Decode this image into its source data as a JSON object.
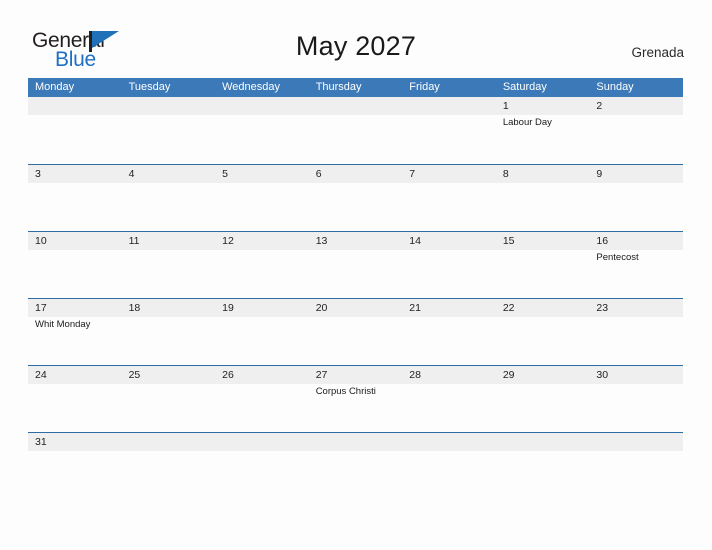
{
  "brand": {
    "name_part1": "General",
    "name_part2": "Blue",
    "flag_icon": "flag-icon"
  },
  "header": {
    "title": "May 2027",
    "region": "Grenada"
  },
  "colors": {
    "header_blue": "#3b79b8",
    "rule_blue": "#2e6da4",
    "band_gray": "#efefef",
    "brand_blue": "#1f6fc4",
    "page_bg": "#fdfdfd"
  },
  "calendar": {
    "weekday_headers": [
      "Monday",
      "Tuesday",
      "Wednesday",
      "Thursday",
      "Friday",
      "Saturday",
      "Sunday"
    ],
    "weeks": [
      [
        {
          "day": "",
          "events": []
        },
        {
          "day": "",
          "events": []
        },
        {
          "day": "",
          "events": []
        },
        {
          "day": "",
          "events": []
        },
        {
          "day": "",
          "events": []
        },
        {
          "day": "1",
          "events": [
            "Labour Day"
          ]
        },
        {
          "day": "2",
          "events": []
        }
      ],
      [
        {
          "day": "3",
          "events": []
        },
        {
          "day": "4",
          "events": []
        },
        {
          "day": "5",
          "events": []
        },
        {
          "day": "6",
          "events": []
        },
        {
          "day": "7",
          "events": []
        },
        {
          "day": "8",
          "events": []
        },
        {
          "day": "9",
          "events": []
        }
      ],
      [
        {
          "day": "10",
          "events": []
        },
        {
          "day": "11",
          "events": []
        },
        {
          "day": "12",
          "events": []
        },
        {
          "day": "13",
          "events": []
        },
        {
          "day": "14",
          "events": []
        },
        {
          "day": "15",
          "events": []
        },
        {
          "day": "16",
          "events": [
            "Pentecost"
          ]
        }
      ],
      [
        {
          "day": "17",
          "events": [
            "Whit Monday"
          ]
        },
        {
          "day": "18",
          "events": []
        },
        {
          "day": "19",
          "events": []
        },
        {
          "day": "20",
          "events": []
        },
        {
          "day": "21",
          "events": []
        },
        {
          "day": "22",
          "events": []
        },
        {
          "day": "23",
          "events": []
        }
      ],
      [
        {
          "day": "24",
          "events": []
        },
        {
          "day": "25",
          "events": []
        },
        {
          "day": "26",
          "events": []
        },
        {
          "day": "27",
          "events": [
            "Corpus Christi"
          ]
        },
        {
          "day": "28",
          "events": []
        },
        {
          "day": "29",
          "events": []
        },
        {
          "day": "30",
          "events": []
        }
      ],
      [
        {
          "day": "31",
          "events": []
        },
        {
          "day": "",
          "events": []
        },
        {
          "day": "",
          "events": []
        },
        {
          "day": "",
          "events": []
        },
        {
          "day": "",
          "events": []
        },
        {
          "day": "",
          "events": []
        },
        {
          "day": "",
          "events": []
        }
      ]
    ]
  }
}
